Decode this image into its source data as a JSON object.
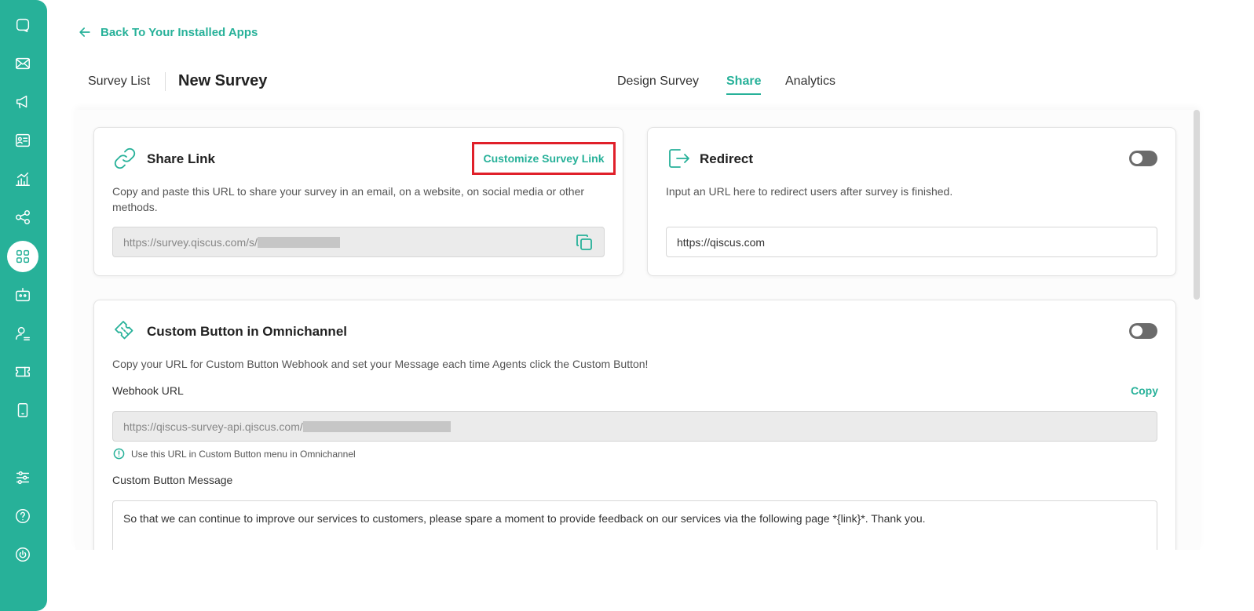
{
  "header": {
    "back_label": "Back To Your Installed Apps",
    "breadcrumb_list": "Survey List",
    "page_title": "New Survey"
  },
  "tabs": [
    {
      "label": "Design Survey",
      "active": false
    },
    {
      "label": "Share",
      "active": true
    },
    {
      "label": "Analytics",
      "active": false
    }
  ],
  "sidebar": {
    "items": [
      {
        "icon": "chat-icon"
      },
      {
        "icon": "mail-icon"
      },
      {
        "icon": "megaphone-icon"
      },
      {
        "icon": "contact-card-icon"
      },
      {
        "icon": "analytics-icon"
      },
      {
        "icon": "share-nodes-icon"
      },
      {
        "icon": "apps-grid-icon",
        "active": true
      },
      {
        "icon": "bot-icon"
      },
      {
        "icon": "agent-icon"
      },
      {
        "icon": "ticket-icon"
      },
      {
        "icon": "mobile-icon"
      },
      {
        "icon": "settings-sliders-icon"
      },
      {
        "icon": "help-icon"
      },
      {
        "icon": "power-icon"
      }
    ]
  },
  "share_link": {
    "title": "Share Link",
    "customize_label": "Customize Survey Link",
    "description": "Copy and paste this URL to share your survey in an email, on a website, on social media or other methods.",
    "url": "https://survey.qiscus.com/s/"
  },
  "redirect": {
    "title": "Redirect",
    "description": "Input an URL here to redirect users after survey is finished.",
    "url": "https://qiscus.com",
    "enabled": false
  },
  "custom_button": {
    "title": "Custom Button in Omnichannel",
    "description": "Copy your URL for Custom Button Webhook and set your Message each time Agents click the Custom Button!",
    "webhook_label": "Webhook URL",
    "copy_label": "Copy",
    "webhook_url": "https://qiscus-survey-api.qiscus.com/",
    "hint": "Use this URL in Custom Button menu in Omnichannel",
    "message_label": "Custom Button Message",
    "message": "So that we can continue to improve our services to customers, please spare a moment to provide feedback on our services via the following page *{link}*. Thank you.",
    "enabled": false
  },
  "colors": {
    "accent": "#27b199",
    "highlight_border": "#e0202a"
  }
}
